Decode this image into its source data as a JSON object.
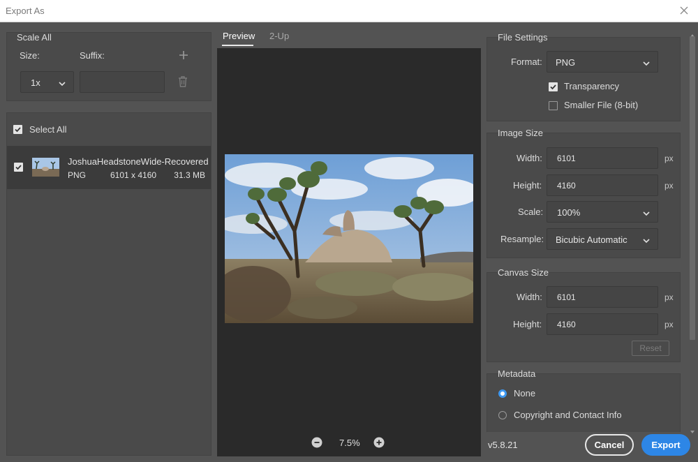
{
  "window": {
    "title": "Export As"
  },
  "scale_all": {
    "header": "Scale All",
    "size_label": "Size:",
    "suffix_label": "Suffix:",
    "size_value": "1x",
    "suffix_value": ""
  },
  "file_list": {
    "select_all_label": "Select All",
    "items": [
      {
        "name": "JoshuaHeadstoneWide-Recovered",
        "format": "PNG",
        "dimensions": "6101 x 4160",
        "size": "31.3 MB"
      }
    ]
  },
  "preview": {
    "tabs": [
      {
        "label": "Preview"
      },
      {
        "label": "2-Up"
      }
    ],
    "zoom": "7.5%"
  },
  "file_settings": {
    "header": "File Settings",
    "format_label": "Format:",
    "format_value": "PNG",
    "transparency_label": "Transparency",
    "smaller_file_label": "Smaller File (8-bit)"
  },
  "image_size": {
    "header": "Image Size",
    "width_label": "Width:",
    "width_value": "6101",
    "height_label": "Height:",
    "height_value": "4160",
    "scale_label": "Scale:",
    "scale_value": "100%",
    "resample_label": "Resample:",
    "resample_value": "Bicubic Automatic",
    "unit": "px"
  },
  "canvas_size": {
    "header": "Canvas Size",
    "width_label": "Width:",
    "width_value": "6101",
    "height_label": "Height:",
    "height_value": "4160",
    "unit": "px",
    "reset_label": "Reset"
  },
  "metadata": {
    "header": "Metadata",
    "none_label": "None",
    "copyright_label": "Copyright and Contact Info"
  },
  "footer": {
    "version": "v5.8.21",
    "cancel_label": "Cancel",
    "export_label": "Export"
  },
  "colors": {
    "accent": "#2d86e6",
    "radio": "#3e98f0"
  }
}
